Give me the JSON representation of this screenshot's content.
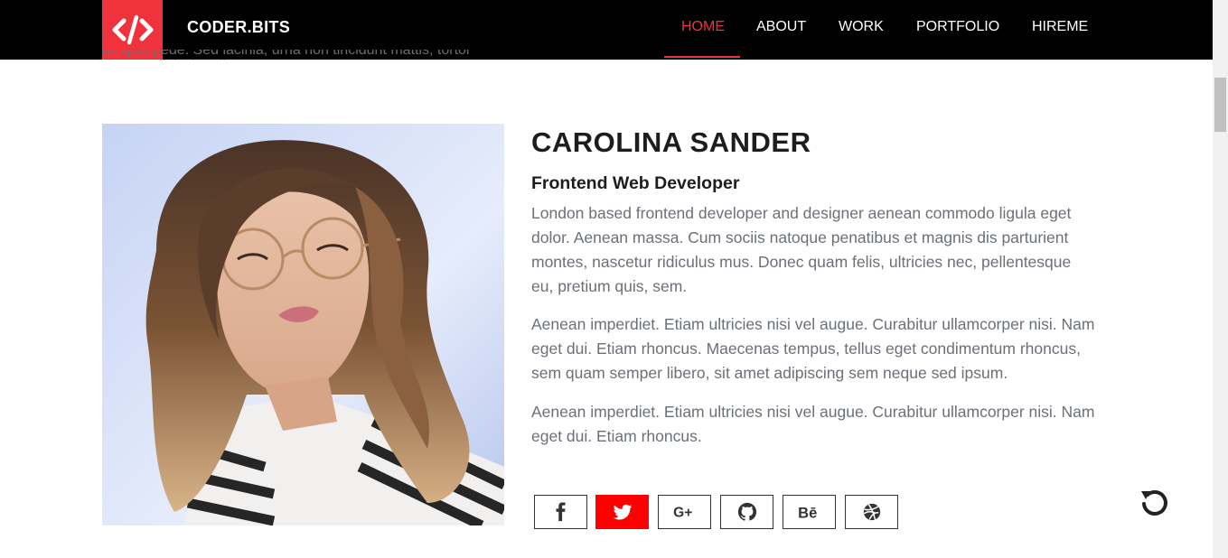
{
  "brand": {
    "name": "CODER.BITS",
    "logo_icon": "code-brackets-icon",
    "accent": "#f0323c"
  },
  "nav": {
    "items": [
      {
        "label": "HOME",
        "active": true
      },
      {
        "label": "ABOUT",
        "active": false
      },
      {
        "label": "WORK",
        "active": false
      },
      {
        "label": "PORTFOLIO",
        "active": false
      },
      {
        "label": "HIREME",
        "active": false
      }
    ]
  },
  "cutoff_text": "ue quis pede. Sed lacinia, urna non tincidunt mattis, tortor neque adipiscing diam",
  "profile": {
    "name": "CAROLINA SANDER",
    "role": "Frontend Web Developer",
    "paragraphs": [
      "London based frontend developer and designer aenean commodo ligula eget dolor. Aenean massa. Cum sociis natoque penatibus et magnis dis parturient montes, nascetur ridiculus mus. Donec quam felis, ultricies nec, pellentesque eu, pretium quis, sem.",
      "Aenean imperdiet. Etiam ultricies nisi vel augue. Curabitur ullamcorper nisi. Nam eget dui. Etiam rhoncus. Maecenas tempus, tellus eget condimentum rhoncus, sem quam semper libero, sit amet adipiscing sem neque sed ipsum.",
      "Aenean imperdiet. Etiam ultricies nisi vel augue. Curabitur ullamcorper nisi. Nam eget dui. Etiam rhoncus."
    ]
  },
  "social": [
    {
      "icon": "facebook-icon",
      "active": false
    },
    {
      "icon": "twitter-icon",
      "active": true
    },
    {
      "icon": "google-plus-icon",
      "active": false
    },
    {
      "icon": "github-icon",
      "active": false
    },
    {
      "icon": "behance-icon",
      "active": false
    },
    {
      "icon": "dribbble-icon",
      "active": false
    }
  ],
  "reload_icon": "reload-icon"
}
